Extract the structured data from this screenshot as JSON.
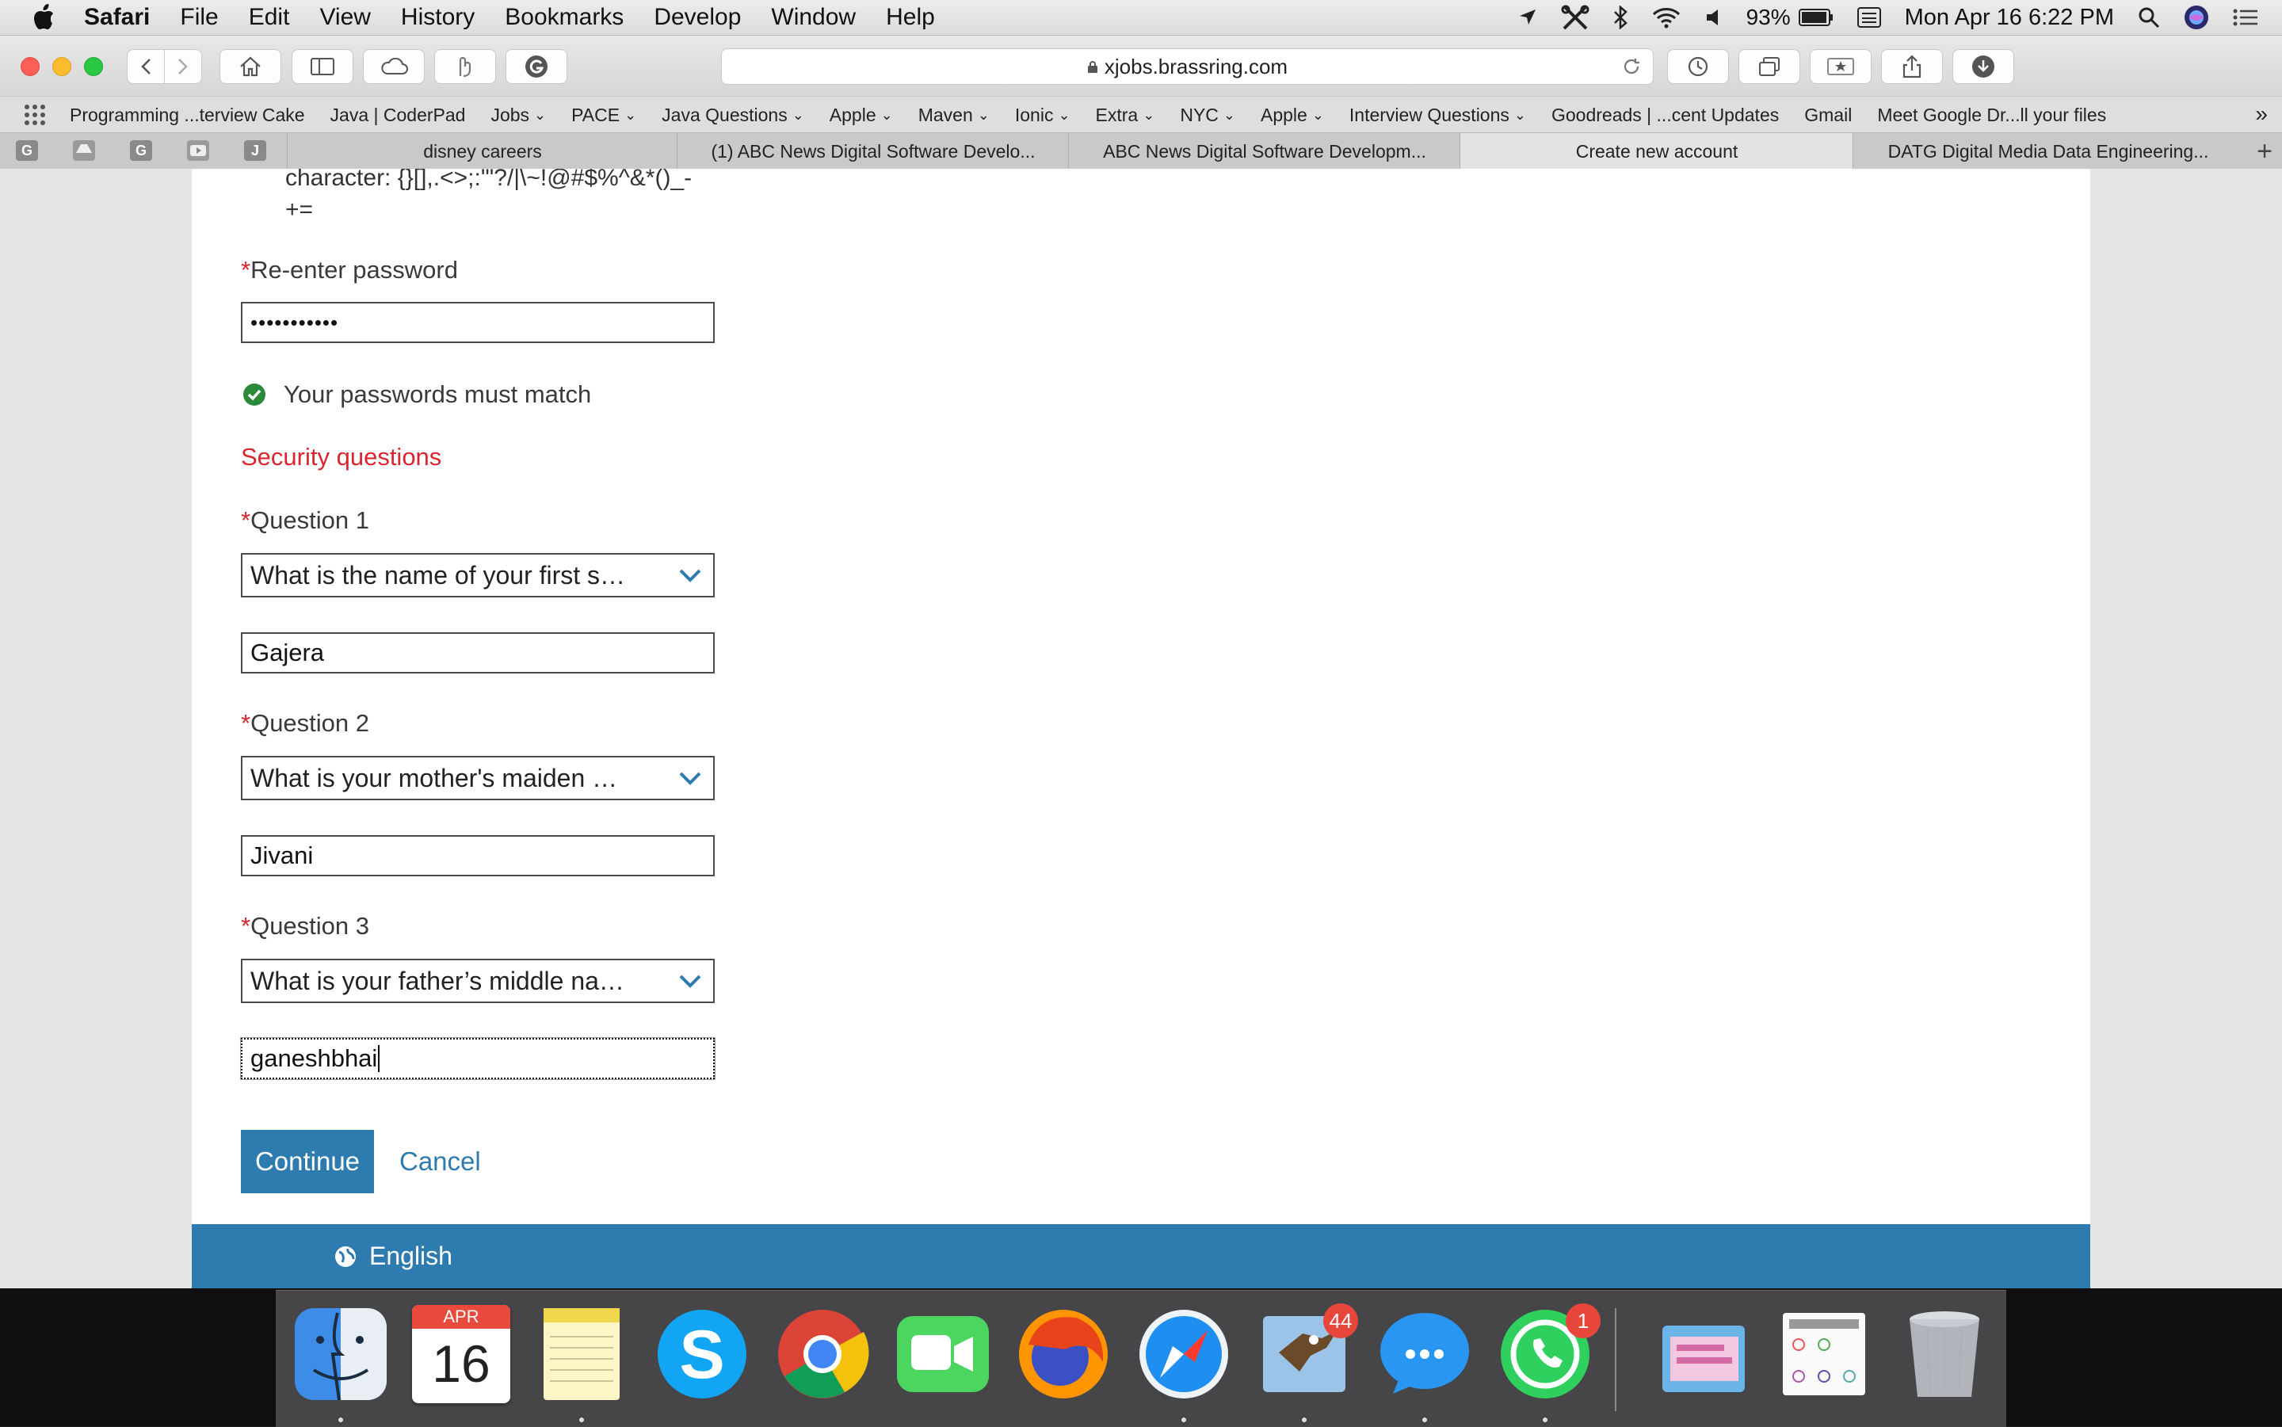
{
  "menubar": {
    "app_name": "Safari",
    "items": [
      "File",
      "Edit",
      "View",
      "History",
      "Bookmarks",
      "Develop",
      "Window",
      "Help"
    ],
    "battery": "93%",
    "datetime": "Mon Apr 16  6:22 PM"
  },
  "toolbar": {
    "url": "xjobs.brassring.com"
  },
  "bookmarks": [
    {
      "label": "Programming ...terview Cake",
      "menu": false
    },
    {
      "label": "Java | CoderPad",
      "menu": false
    },
    {
      "label": "Jobs",
      "menu": true
    },
    {
      "label": "PACE",
      "menu": true
    },
    {
      "label": "Java Questions",
      "menu": true
    },
    {
      "label": "Apple",
      "menu": true
    },
    {
      "label": "Maven",
      "menu": true
    },
    {
      "label": "Ionic",
      "menu": true
    },
    {
      "label": "Extra",
      "menu": true
    },
    {
      "label": "NYC",
      "menu": true
    },
    {
      "label": "Apple",
      "menu": true
    },
    {
      "label": "Interview Questions",
      "menu": true
    },
    {
      "label": "Goodreads | ...cent Updates",
      "menu": false
    },
    {
      "label": "Gmail",
      "menu": false
    },
    {
      "label": "Meet Google Dr...ll your files",
      "menu": false
    }
  ],
  "tabs": [
    {
      "label": "disney careers",
      "active": false
    },
    {
      "label": "(1) ABC News Digital Software Develo...",
      "active": false
    },
    {
      "label": "ABC News Digital Software Developm...",
      "active": false
    },
    {
      "label": "Create new account",
      "active": true
    },
    {
      "label": "DATG Digital Media Data Engineering...",
      "active": false
    }
  ],
  "pinned_tabs": [
    "G",
    "",
    "G",
    "",
    "J"
  ],
  "form": {
    "pw_rule_line1": "character: {}[],.<>;:'\"?/|\\~!@#$%^&*()_-",
    "pw_rule_line2": "+=",
    "required_mark": "*",
    "reenter_label": "Re-enter password",
    "reenter_value": "•••••••••••",
    "match_text": "Your passwords must match",
    "section_title": "Security questions",
    "questions": [
      {
        "label": "Question 1",
        "selected": "What is the name of your first s…",
        "answer": "Gajera"
      },
      {
        "label": "Question 2",
        "selected": "What is your mother's maiden …",
        "answer": "Jivani"
      },
      {
        "label": "Question 3",
        "selected": "What is your father’s middle na…",
        "answer": "ganeshbhai"
      }
    ],
    "continue_label": "Continue",
    "cancel_label": "Cancel"
  },
  "footer": {
    "language": "English"
  },
  "dock": {
    "calendar_month": "APR",
    "calendar_day": "16",
    "mail_badge": "44",
    "whatsapp_badge": "1"
  },
  "colors": {
    "accent": "#2e7bb0",
    "required": "#d9262f",
    "success": "#2a8a3a"
  }
}
